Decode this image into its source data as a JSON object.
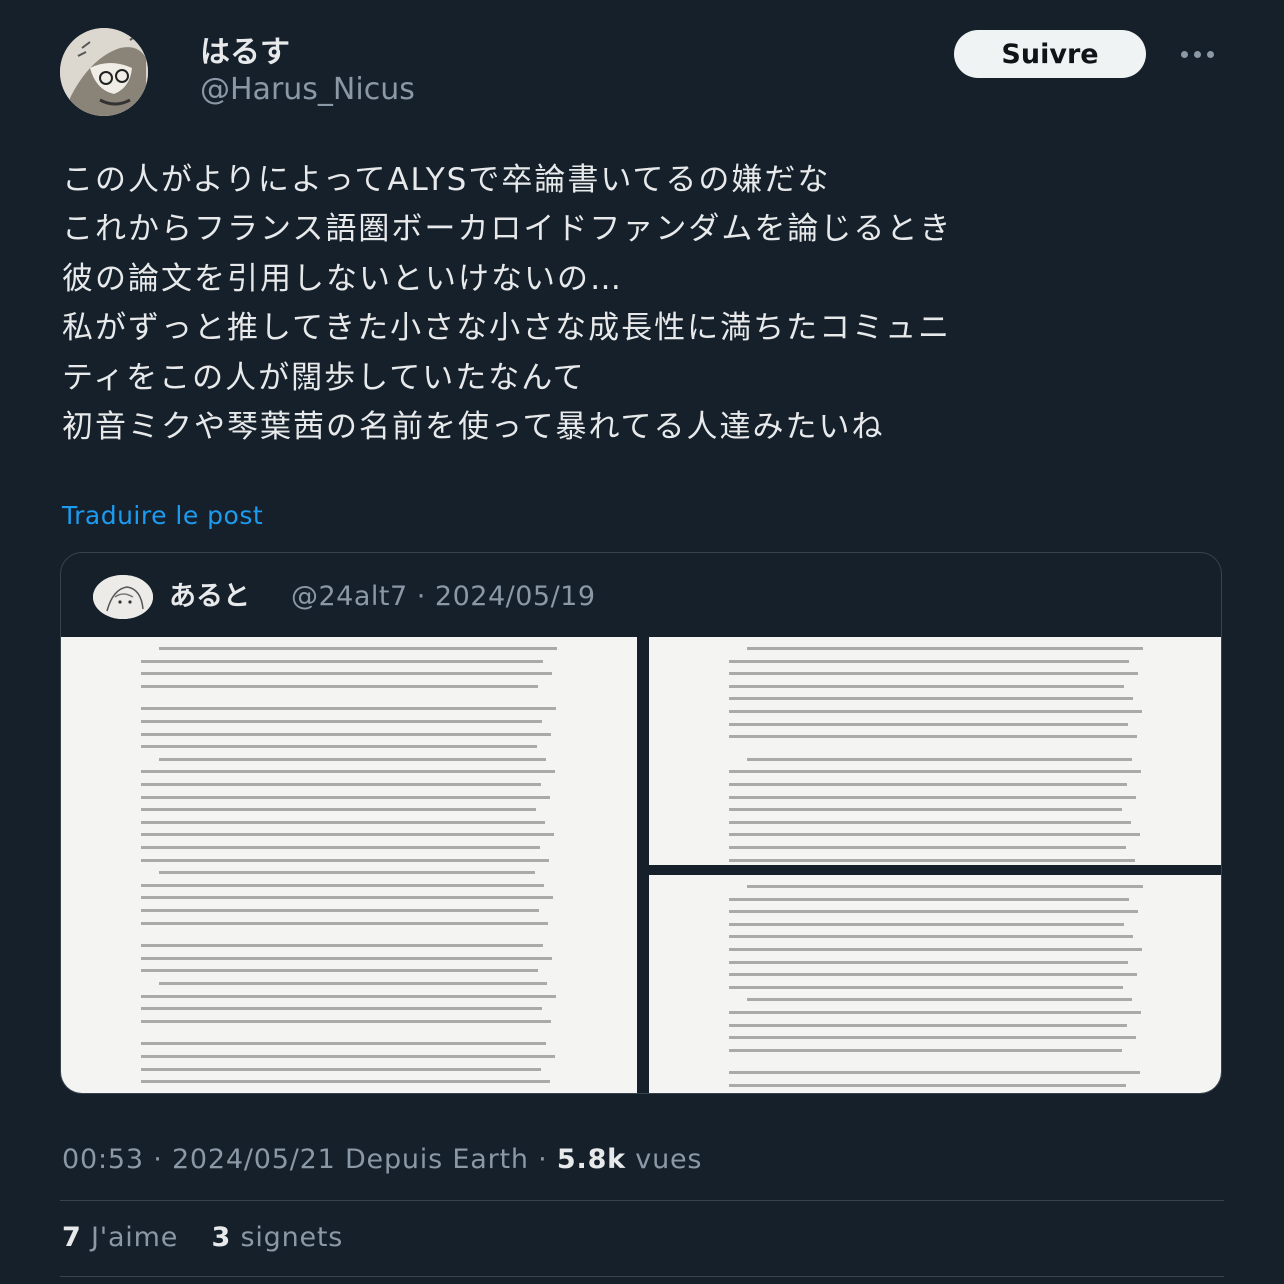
{
  "author": {
    "display_name": "はるす",
    "handle": "@Harus_Nicus"
  },
  "follow_label": "Suivre",
  "tweet_lines": [
    "この人がよりによってALYSで卒論書いてるの嫌だな",
    "これからフランス語圏ボーカロイドファンダムを論じるとき",
    "彼の論文を引用しないといけないの…",
    "私がずっと推してきた小さな小さな成長性に満ちたコミュニ",
    "ティをこの人が闊歩していたなんて",
    "初音ミクや琴葉茜の名前を使って暴れてる人達みたいね"
  ],
  "translate_label": "Traduire le post",
  "quoted": {
    "display_name": "あると",
    "meta": "@24alt7 · 2024/05/19",
    "images": [
      {
        "name": "apology-page-1"
      },
      {
        "name": "apology-page-2"
      },
      {
        "name": "apology-page-3"
      }
    ]
  },
  "meta": {
    "time_date": "00:53 · 2024/05/21 Depuis Earth · ",
    "views_count": "5.8k",
    "views_label": " vues"
  },
  "stats": {
    "likes_count": "7",
    "likes_label": " J'aime",
    "bookmarks_count": "3",
    "bookmarks_label": " signets"
  },
  "colors": {
    "background": "#15202b",
    "link": "#1d9bf0",
    "secondary_text": "#8b98a5",
    "follow_button_bg": "#eff3f4"
  }
}
